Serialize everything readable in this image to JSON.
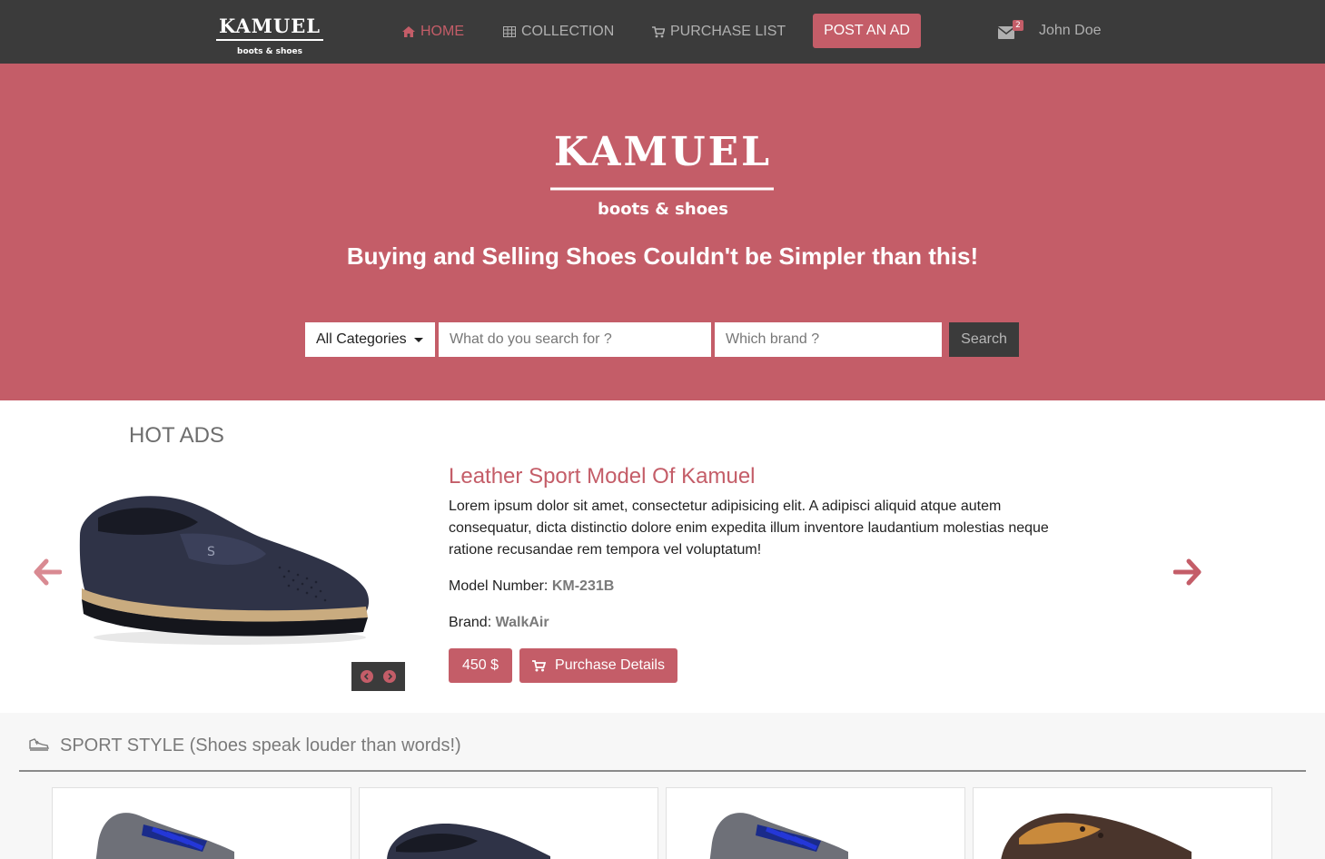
{
  "colors": {
    "accent": "#c45d68",
    "nav_bg": "#3b3b3b",
    "nav_text": "#b0b0b0",
    "section_bg": "#f7f7f7"
  },
  "brand": {
    "name": "KAMUEL",
    "sub": "boots & shoes"
  },
  "nav": {
    "items": [
      {
        "label": "HOME",
        "icon": "home-icon",
        "active": true
      },
      {
        "label": "COLLECTION",
        "icon": "table-icon",
        "active": false
      },
      {
        "label": "PURCHASE LIST",
        "icon": "cart-icon",
        "active": false
      }
    ],
    "post_ad": "POST AN AD",
    "messages": {
      "icon": "envelope-icon",
      "count": "2"
    },
    "user": "John Doe"
  },
  "hero": {
    "tagline": "Buying and Selling Shoes Couldn't be Simpler than this!",
    "search": {
      "category": "All Categories",
      "query_placeholder": "What do you search for ?",
      "brand_placeholder": "Which brand ?",
      "button": "Search"
    }
  },
  "hot_ads": {
    "title": "HOT ADS",
    "product": {
      "title": "Leather Sport Model Of Kamuel",
      "description": "Lorem ipsum dolor sit amet, consectetur adipisicing elit. A adipisci aliquid atque autem consequatur, dicta distinctio dolore enim expedita illum inventore laudantium molestias neque ratione recusandae rem tempora vel voluptatum!",
      "model_label": "Model Number:",
      "model": "KM-231B",
      "brand_label": "Brand:",
      "brand": "WalkAir",
      "price": "450 $",
      "purchase": "Purchase Details"
    }
  },
  "sport": {
    "title": "SPORT STYLE (Shoes speak louder than words!)",
    "icon": "sneaker-icon",
    "cards": [
      {
        "color": "blue-grey"
      },
      {
        "color": "navy-loafer"
      },
      {
        "color": "blue-grey"
      },
      {
        "color": "brown-leather"
      }
    ]
  }
}
